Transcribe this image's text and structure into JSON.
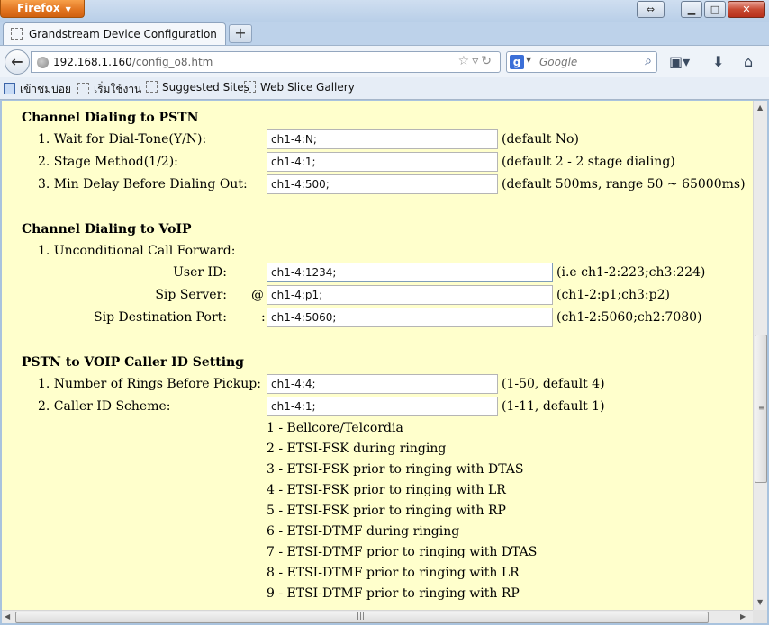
{
  "browser": {
    "app_button": "Firefox",
    "tab_title": "Grandstream Device Configuration",
    "new_tab": "+",
    "url_host": "192.168.1.160",
    "url_path": "/config_o8.htm",
    "search_placeholder": "Google",
    "search_engine_letter": "g",
    "bookmarks": [
      "เข้าชมบ่อย",
      "เริ่มใช้งาน",
      "Suggested Sites",
      "Web Slice Gallery"
    ]
  },
  "pstn_dialing": {
    "title": "Channel Dialing to PSTN",
    "rows": [
      {
        "label": "1. Wait for Dial-Tone(Y/N):",
        "value": "ch1-4:N;",
        "note": "(default No)"
      },
      {
        "label": "2. Stage Method(1/2):",
        "value": "ch1-4:1;",
        "note": "(default 2 - 2 stage dialing)"
      },
      {
        "label": "3. Min Delay Before Dialing Out:",
        "value": "ch1-4:500;",
        "note": "(default 500ms, range 50 ~ 65000ms)"
      }
    ]
  },
  "voip_dialing": {
    "title": "Channel Dialing to VoIP",
    "subtitle": "1. Unconditional Call Forward:",
    "rows": [
      {
        "label": "User ID:",
        "prefix": "",
        "value": "ch1-4:1234;",
        "note": "(i.e ch1-2:223;ch3:224)"
      },
      {
        "label": "Sip Server:",
        "prefix": "@",
        "value": "ch1-4:p1;",
        "note": "(ch1-2:p1;ch3:p2)"
      },
      {
        "label": "Sip Destination Port:",
        "prefix": ":",
        "value": "ch1-4:5060;",
        "note": "(ch1-2:5060;ch2:7080)"
      }
    ]
  },
  "caller_id": {
    "title": "PSTN to VOIP Caller ID Setting",
    "rows": [
      {
        "label": "1. Number of Rings Before Pickup:",
        "value": "ch1-4:4;",
        "note": "(1-50, default 4)"
      },
      {
        "label": "2. Caller ID Scheme:",
        "value": "ch1-4:1;",
        "note": "(1-11, default 1)"
      }
    ],
    "options": [
      "1 - Bellcore/Telcordia",
      "2 - ETSI-FSK during ringing",
      "3 - ETSI-FSK prior to ringing with DTAS",
      "4 - ETSI-FSK prior to ringing with LR",
      "5 - ETSI-FSK prior to ringing with RP",
      "6 - ETSI-DTMF during ringing",
      "7 - ETSI-DTMF prior to ringing with DTAS",
      "8 - ETSI-DTMF prior to ringing with LR",
      "9 - ETSI-DTMF prior to ringing with RP"
    ]
  }
}
